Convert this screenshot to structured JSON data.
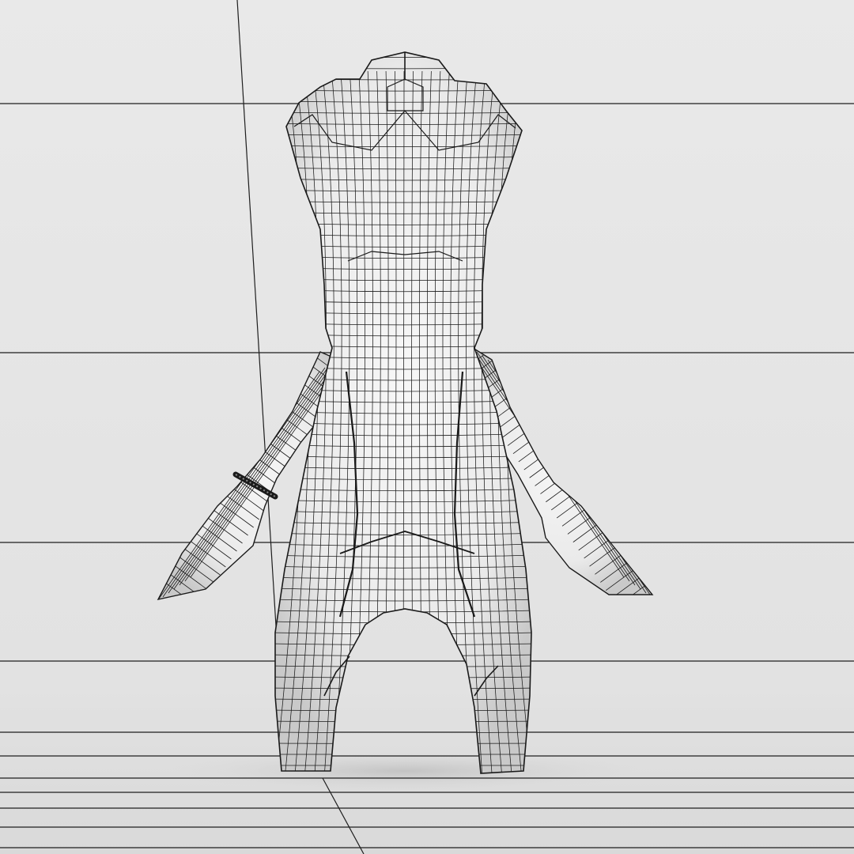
{
  "scene": {
    "background_color": "#e6e6e6",
    "floor_color": "#dcdcdc",
    "mesh_fill_color": "#f1f1f1",
    "mesh_shade_color": "#c8c8c8",
    "wire_color": "#1a1a1a",
    "grid_color": "#1e1e1e",
    "icons": [
      "wireframe-character-model",
      "wrist-bracelet",
      "reference-grid"
    ]
  }
}
